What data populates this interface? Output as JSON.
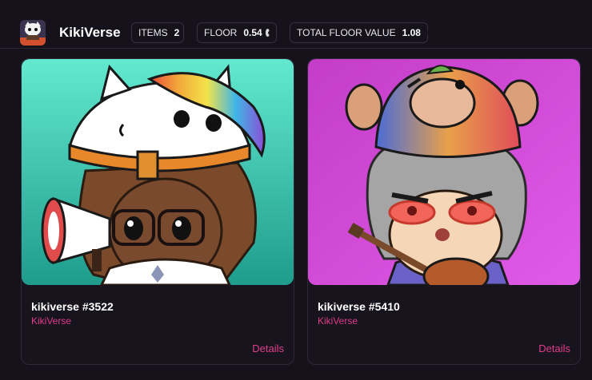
{
  "collection": {
    "name": "KikiVerse",
    "avatar_icon": "kikiverse-avatar"
  },
  "stats": {
    "items_label": "ITEMS",
    "items_value": "2",
    "floor_label": "FLOOR",
    "floor_value": "0.54",
    "total_floor_label": "TOTAL FLOOR VALUE",
    "total_floor_value": "1.08",
    "currency_icon": "eth-icon"
  },
  "cards": [
    {
      "title": "kikiverse #3522",
      "collection": "KikiVerse",
      "details_label": "Details",
      "background": "teal-gradient",
      "art": "cat-hat-character-with-megaphone"
    },
    {
      "title": "kikiverse #5410",
      "collection": "KikiVerse",
      "details_label": "Details",
      "background": "magenta-gradient",
      "art": "monkey-hat-character-with-guitar"
    }
  ],
  "colors": {
    "background": "#15121c",
    "accent": "#e03c8a",
    "card_border": "#2e2a37"
  }
}
